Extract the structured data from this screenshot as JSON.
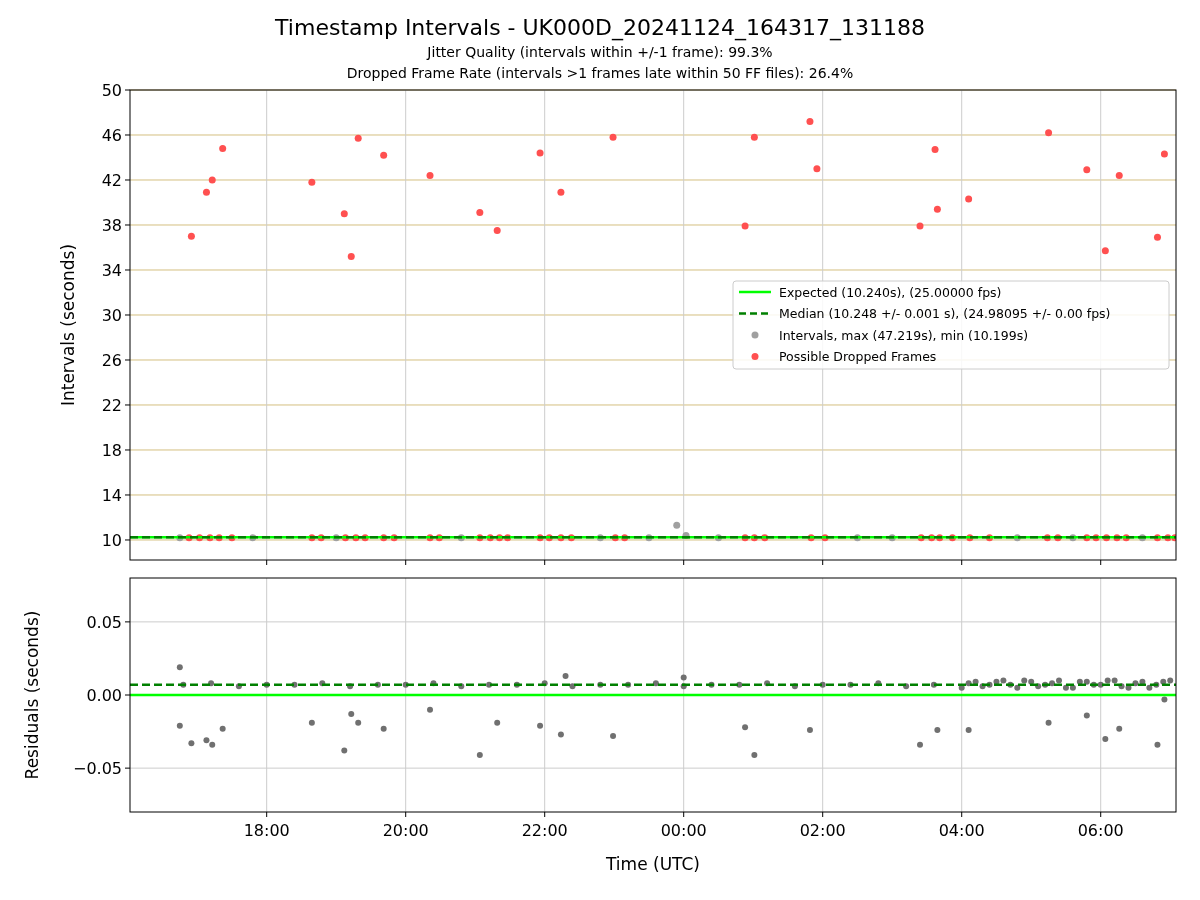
{
  "figure": {
    "title": "Timestamp Intervals - UK000D_20241124_164317_131188",
    "subtitle_lines": [
      "Jitter Quality (intervals within +/-1 frame): 99.3%",
      "Dropped Frame Rate (intervals >1 frames late within 50 FF files): 26.4%"
    ]
  },
  "interval_plot": {
    "chart_data": {
      "type": "scatter",
      "grid": true,
      "legend": true,
      "ylabel": "Intervals (seconds)",
      "xlim": [
        "2024-11-24T16:02",
        "2024-11-25T07:05"
      ],
      "ylim": [
        8.22,
        50
      ],
      "yticks": [
        {
          "value": 10,
          "label": "10"
        },
        {
          "value": 14,
          "label": "14"
        },
        {
          "value": 18,
          "label": "18"
        },
        {
          "value": 22,
          "label": "22"
        },
        {
          "value": 26,
          "label": "26"
        },
        {
          "value": 30,
          "label": "30"
        },
        {
          "value": 34,
          "label": "34"
        },
        {
          "value": 38,
          "label": "38"
        },
        {
          "value": 42,
          "label": "42"
        },
        {
          "value": 46,
          "label": "46"
        },
        {
          "value": 50,
          "label": "50"
        }
      ],
      "series": [
        {
          "name": "Expected (10.240s), (25.00000 fps)",
          "color": "#00ff00",
          "type": "line",
          "line_style": "solid",
          "x": [
            "2024-11-24T16:02",
            "2024-11-25T07:05"
          ],
          "values": [
            10.24,
            10.24
          ]
        },
        {
          "name": "Median (10.248 +/- 0.001 s), (24.98095 +/- 0.00 fps)",
          "color": "#008000",
          "type": "line",
          "line_style": "dashed",
          "x": [
            "2024-11-24T16:02",
            "2024-11-25T07:05"
          ],
          "values": [
            10.25,
            10.25
          ]
        },
        {
          "name": "Intervals, max (47.219s), min (10.199s)",
          "color": "#a0a0a0",
          "type": "scatter",
          "x": [
            "2024-11-24T16:45",
            "2024-11-24T17:48",
            "2024-11-24T19:00",
            "2024-11-24T20:48",
            "2024-11-24T22:48",
            "2024-11-24T23:30",
            "2024-11-24T23:54",
            "2024-11-25T00:02",
            "2024-11-25T00:30",
            "2024-11-25T02:30",
            "2024-11-25T03:00",
            "2024-11-25T04:48",
            "2024-11-25T05:36",
            "2024-11-25T06:36"
          ],
          "values": [
            10.2,
            10.2,
            10.2,
            10.2,
            10.2,
            10.2,
            11.3,
            10.4,
            10.2,
            10.2,
            10.2,
            10.2,
            10.2,
            10.2
          ]
        },
        {
          "name": "Possible Dropped Frames",
          "color": "#ff5050",
          "type": "scatter",
          "x": [
            "2024-11-24T16:55",
            "2024-11-24T17:08",
            "2024-11-24T17:13",
            "2024-11-24T17:22",
            "2024-11-24T18:39",
            "2024-11-24T19:07",
            "2024-11-24T19:13",
            "2024-11-24T19:19",
            "2024-11-24T19:41",
            "2024-11-24T20:21",
            "2024-11-24T21:04",
            "2024-11-24T21:19",
            "2024-11-24T21:56",
            "2024-11-24T22:14",
            "2024-11-24T22:59",
            "2024-11-25T00:53",
            "2024-11-25T01:01",
            "2024-11-25T01:49",
            "2024-11-25T01:55",
            "2024-11-25T03:24",
            "2024-11-25T03:37",
            "2024-11-25T03:39",
            "2024-11-25T04:06",
            "2024-11-25T05:15",
            "2024-11-25T05:48",
            "2024-11-25T06:04",
            "2024-11-25T06:16",
            "2024-11-25T06:49",
            "2024-11-25T06:55"
          ],
          "values": [
            37.0,
            40.9,
            42.0,
            44.8,
            41.8,
            39.0,
            35.2,
            45.7,
            44.2,
            42.4,
            39.1,
            37.5,
            44.4,
            40.9,
            45.8,
            37.9,
            45.8,
            47.2,
            43.0,
            37.9,
            44.7,
            39.4,
            40.3,
            46.2,
            42.9,
            35.7,
            42.4,
            36.9,
            44.3
          ]
        },
        {
          "color": "#ff5050",
          "type": "scatter",
          "x": [
            "2024-11-24T16:53",
            "2024-11-24T17:02",
            "2024-11-24T17:11",
            "2024-11-24T17:19",
            "2024-11-24T17:30",
            "2024-11-24T18:39",
            "2024-11-24T18:47",
            "2024-11-24T19:08",
            "2024-11-24T19:17",
            "2024-11-24T19:25",
            "2024-11-24T19:41",
            "2024-11-24T19:50",
            "2024-11-24T20:21",
            "2024-11-24T20:29",
            "2024-11-24T21:04",
            "2024-11-24T21:13",
            "2024-11-24T21:21",
            "2024-11-24T21:28",
            "2024-11-24T21:56",
            "2024-11-24T22:04",
            "2024-11-24T22:14",
            "2024-11-24T22:23",
            "2024-11-24T23:01",
            "2024-11-24T23:09",
            "2024-11-25T00:53",
            "2024-11-25T01:01",
            "2024-11-25T01:10",
            "2024-11-25T01:50",
            "2024-11-25T02:02",
            "2024-11-25T03:25",
            "2024-11-25T03:34",
            "2024-11-25T03:41",
            "2024-11-25T03:52",
            "2024-11-25T04:07",
            "2024-11-25T04:24",
            "2024-11-25T05:14",
            "2024-11-25T05:23",
            "2024-11-25T05:48",
            "2024-11-25T05:56",
            "2024-11-25T06:05",
            "2024-11-25T06:14",
            "2024-11-25T06:22",
            "2024-11-25T06:49",
            "2024-11-25T06:58",
            "2024-11-25T07:04"
          ],
          "values": [
            10.2,
            10.2,
            10.2,
            10.2,
            10.2,
            10.2,
            10.2,
            10.2,
            10.2,
            10.2,
            10.2,
            10.2,
            10.2,
            10.2,
            10.2,
            10.2,
            10.2,
            10.2,
            10.2,
            10.2,
            10.2,
            10.2,
            10.2,
            10.2,
            10.2,
            10.2,
            10.2,
            10.2,
            10.2,
            10.2,
            10.2,
            10.2,
            10.2,
            10.2,
            10.2,
            10.2,
            10.2,
            10.2,
            10.2,
            10.2,
            10.2,
            10.2,
            10.2,
            10.2,
            10.2
          ]
        }
      ]
    }
  },
  "residual_plot": {
    "chart_data": {
      "type": "scatter",
      "grid": true,
      "xlabel": "Time (UTC)",
      "ylabel": "Residuals (seconds)",
      "xlim": [
        "2024-11-24T16:02",
        "2024-11-25T07:05"
      ],
      "ylim": [
        -0.08,
        0.08
      ],
      "xticks": [
        {
          "value": "2024-11-24T18:00",
          "label": "18:00"
        },
        {
          "value": "2024-11-24T20:00",
          "label": "20:00"
        },
        {
          "value": "2024-11-24T22:00",
          "label": "22:00"
        },
        {
          "value": "2024-11-25T00:00",
          "label": "00:00"
        },
        {
          "value": "2024-11-25T02:00",
          "label": "02:00"
        },
        {
          "value": "2024-11-25T04:00",
          "label": "04:00"
        },
        {
          "value": "2024-11-25T06:00",
          "label": "06:00"
        }
      ],
      "yticks": [
        {
          "value": -0.05,
          "label": "−0.05"
        },
        {
          "value": 0,
          "label": "0.00"
        },
        {
          "value": 0.05,
          "label": "0.05"
        }
      ],
      "series": [
        {
          "color": "#00ff00",
          "type": "line",
          "line_style": "solid",
          "x": [
            "2024-11-24T16:02",
            "2024-11-25T07:05"
          ],
          "values": [
            0,
            0
          ]
        },
        {
          "color": "#008000",
          "type": "line",
          "line_style": "dashed",
          "x": [
            "2024-11-24T16:02",
            "2024-11-25T07:05"
          ],
          "values": [
            0.007,
            0.007
          ]
        },
        {
          "color": "#707070",
          "type": "scatter",
          "x": [
            "2024-11-24T16:45",
            "2024-11-24T16:45",
            "2024-11-24T16:55",
            "2024-11-24T17:08",
            "2024-11-24T17:13",
            "2024-11-24T17:22",
            "2024-11-24T18:39",
            "2024-11-24T19:07",
            "2024-11-24T19:13",
            "2024-11-24T19:19",
            "2024-11-24T19:41",
            "2024-11-24T20:21",
            "2024-11-24T21:04",
            "2024-11-24T21:19",
            "2024-11-24T21:56",
            "2024-11-24T22:14",
            "2024-11-24T22:59",
            "2024-11-25T00:53",
            "2024-11-25T01:01",
            "2024-11-25T01:49",
            "2024-11-25T03:24",
            "2024-11-25T03:39",
            "2024-11-25T04:06",
            "2024-11-25T05:15",
            "2024-11-25T05:48",
            "2024-11-25T06:04",
            "2024-11-25T06:16",
            "2024-11-25T06:49",
            "2024-11-25T06:55",
            "2024-11-24T22:18",
            "2024-11-25T00:00"
          ],
          "values": [
            0.019,
            -0.021,
            -0.033,
            -0.031,
            -0.034,
            -0.023,
            -0.019,
            -0.038,
            -0.013,
            -0.019,
            -0.023,
            -0.01,
            -0.041,
            -0.019,
            -0.021,
            -0.027,
            -0.028,
            -0.022,
            -0.041,
            -0.024,
            -0.034,
            -0.024,
            -0.024,
            -0.019,
            -0.014,
            -0.03,
            -0.023,
            -0.034,
            -0.003,
            0.013,
            0.012
          ]
        },
        {
          "color": "#707070",
          "type": "scatter",
          "x": [
            "2024-11-24T16:48",
            "2024-11-24T17:12",
            "2024-11-24T17:36",
            "2024-11-24T18:00",
            "2024-11-24T18:24",
            "2024-11-24T18:48",
            "2024-11-24T19:12",
            "2024-11-24T19:36",
            "2024-11-24T20:00",
            "2024-11-24T20:24",
            "2024-11-24T20:48",
            "2024-11-24T21:12",
            "2024-11-24T21:36",
            "2024-11-24T22:00",
            "2024-11-24T22:24",
            "2024-11-24T22:48",
            "2024-11-24T23:12",
            "2024-11-24T23:36",
            "2024-11-25T00:00",
            "2024-11-25T00:24",
            "2024-11-25T00:48",
            "2024-11-25T01:12",
            "2024-11-25T01:36",
            "2024-11-25T02:00",
            "2024-11-25T02:24",
            "2024-11-25T02:48",
            "2024-11-25T03:12",
            "2024-11-25T03:36"
          ],
          "values": [
            0.007,
            0.008,
            0.006,
            0.007,
            0.007,
            0.008,
            0.006,
            0.007,
            0.007,
            0.008,
            0.006,
            0.007,
            0.007,
            0.008,
            0.006,
            0.007,
            0.007,
            0.008,
            0.006,
            0.007,
            0.007,
            0.008,
            0.006,
            0.007,
            0.007,
            0.008,
            0.006,
            0.007
          ]
        },
        {
          "color": "#707070",
          "type": "scatter",
          "x": [
            "2024-11-25T04:00",
            "2024-11-25T04:12",
            "2024-11-25T04:24",
            "2024-11-25T04:36",
            "2024-11-25T04:48",
            "2024-11-25T05:00",
            "2024-11-25T05:12",
            "2024-11-25T05:24",
            "2024-11-25T05:36",
            "2024-11-25T05:48",
            "2024-11-25T06:00",
            "2024-11-25T06:12",
            "2024-11-25T06:24",
            "2024-11-25T06:36",
            "2024-11-25T06:48",
            "2024-11-25T07:00"
          ],
          "values": [
            0.005,
            0.009,
            0.007,
            0.01,
            0.005,
            0.009,
            0.007,
            0.01,
            0.005,
            0.009,
            0.007,
            0.01,
            0.005,
            0.009,
            0.007,
            0.01
          ]
        },
        {
          "color": "#707070",
          "type": "scatter",
          "x": [
            "2024-11-25T04:06",
            "2024-11-25T04:18",
            "2024-11-25T04:30",
            "2024-11-25T04:42",
            "2024-11-25T04:54",
            "2024-11-25T05:06",
            "2024-11-25T05:18",
            "2024-11-25T05:30",
            "2024-11-25T05:42",
            "2024-11-25T05:54",
            "2024-11-25T06:06",
            "2024-11-25T06:18",
            "2024-11-25T06:30",
            "2024-11-25T06:42",
            "2024-11-25T06:54"
          ],
          "values": [
            0.008,
            0.006,
            0.009,
            0.007,
            0.01,
            0.006,
            0.008,
            0.005,
            0.009,
            0.007,
            0.01,
            0.006,
            0.008,
            0.005,
            0.009
          ]
        }
      ]
    }
  }
}
